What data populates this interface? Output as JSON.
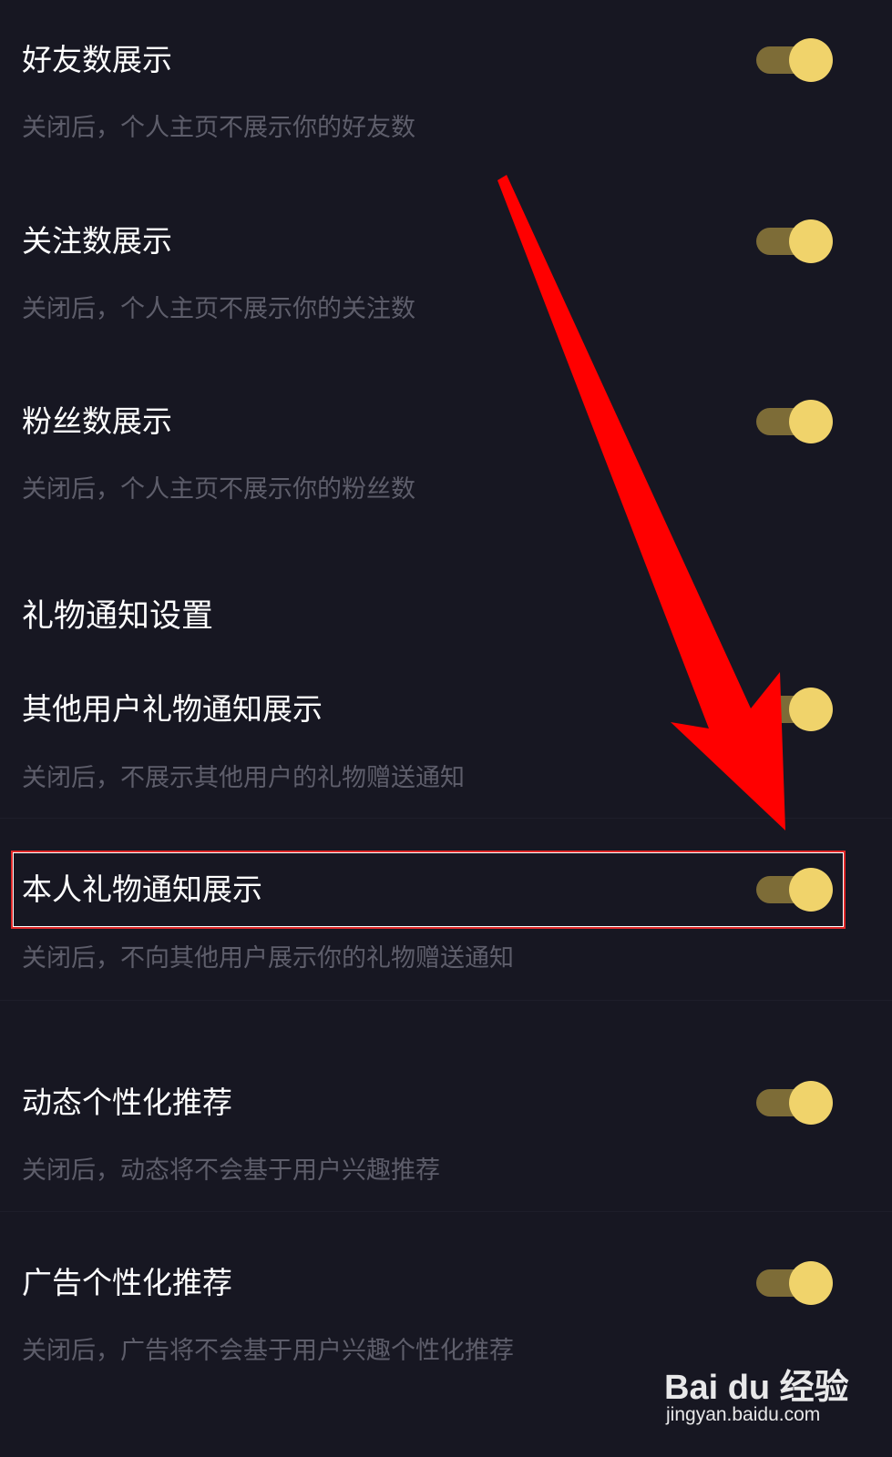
{
  "colors": {
    "background": "#171722",
    "title_text": "#ffffff",
    "desc_text": "#5e5e6b",
    "toggle_track_on": "#7d6c37",
    "toggle_knob_on": "#f0d36b",
    "annotation_red": "#ff0000"
  },
  "settings": {
    "friends_count": {
      "title": "好友数展示",
      "desc": "关闭后，个人主页不展示你的好友数",
      "enabled": true
    },
    "following_count": {
      "title": "关注数展示",
      "desc": "关闭后，个人主页不展示你的关注数",
      "enabled": true
    },
    "followers_count": {
      "title": "粉丝数展示",
      "desc": "关闭后，个人主页不展示你的粉丝数",
      "enabled": true
    },
    "gift_section": {
      "header": "礼物通知设置"
    },
    "others_gift_notice": {
      "title": "其他用户礼物通知展示",
      "desc": "关闭后，不展示其他用户的礼物赠送通知",
      "enabled": true
    },
    "my_gift_notice": {
      "title": "本人礼物通知展示",
      "desc": "关闭后，不向其他用户展示你的礼物赠送通知",
      "enabled": true
    },
    "feed_personalization": {
      "title": "动态个性化推荐",
      "desc": "关闭后，动态将不会基于用户兴趣推荐",
      "enabled": true
    },
    "ad_personalization": {
      "title": "广告个性化推荐",
      "desc": "关闭后，广告将不会基于用户兴趣个性化推荐",
      "enabled": true
    }
  },
  "watermark": {
    "logo": "Bai du 经验",
    "url": "jingyan.baidu.com"
  }
}
